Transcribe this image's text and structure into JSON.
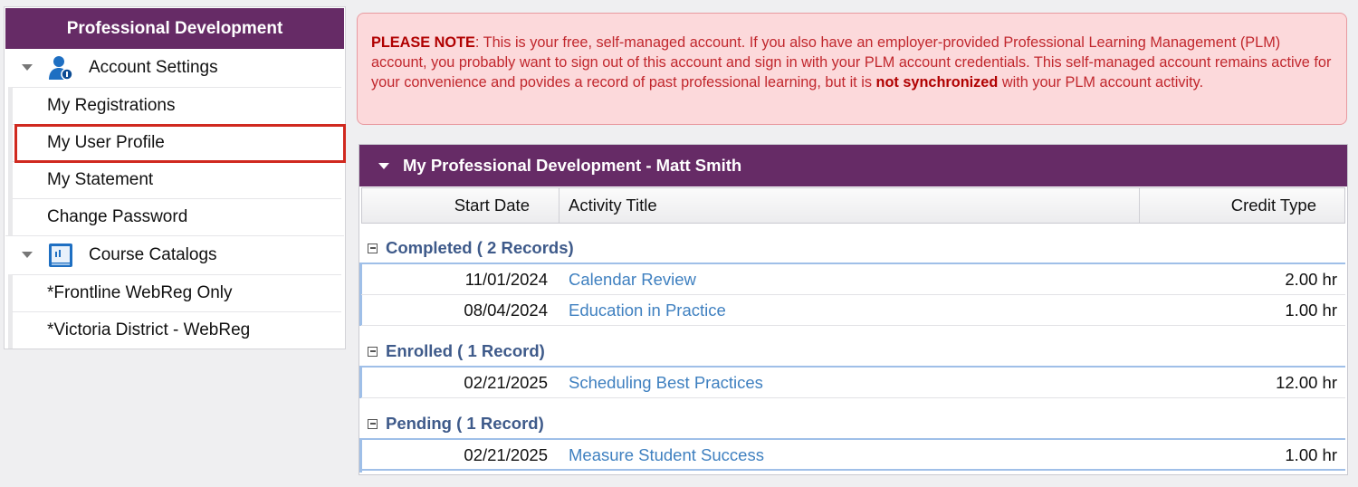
{
  "sidebar": {
    "title": "Professional Development",
    "groups": [
      {
        "label": "Account Settings",
        "icon": "user-settings-icon",
        "items": [
          "My Registrations",
          "My User Profile",
          "My Statement",
          "Change Password"
        ]
      },
      {
        "label": "Course Catalogs",
        "icon": "catalog-icon",
        "items": [
          "*Frontline WebReg Only",
          "*Victoria District - WebReg"
        ]
      }
    ],
    "highlighted_item": "My User Profile"
  },
  "notice": {
    "label": "PLEASE NOTE",
    "text_before": ": This is your free, self-managed account. If you also have an employer-provided Professional Learning Management (PLM) account, you probably want to sign out of this account and sign in with your PLM account credentials. This self-managed account remains active for your convenience and povides a record of past professional learning, but it is ",
    "bold_text": "not synchronized",
    "text_after": " with your PLM account activity."
  },
  "panel": {
    "title": "My Professional Development - Matt Smith",
    "columns": {
      "start_date": "Start Date",
      "activity_title": "Activity Title",
      "credit_type": "Credit Type"
    },
    "groups": [
      {
        "label": "Completed ( 2 Records)",
        "rows": [
          {
            "date": "11/01/2024",
            "title": "Calendar Review",
            "credit": "2.00 hr"
          },
          {
            "date": "08/04/2024",
            "title": "Education in Practice",
            "credit": "1.00 hr"
          }
        ]
      },
      {
        "label": "Enrolled ( 1 Record)",
        "rows": [
          {
            "date": "02/21/2025",
            "title": "Scheduling Best Practices",
            "credit": "12.00 hr"
          }
        ]
      },
      {
        "label": "Pending ( 1 Record)",
        "rows": [
          {
            "date": "02/21/2025",
            "title": "Measure Student Success",
            "credit": "1.00 hr"
          }
        ]
      }
    ]
  },
  "colors": {
    "header_purple": "#662b66",
    "notice_bg": "#fcd9db",
    "notice_text": "#c1272d",
    "link_blue": "#3f80c0",
    "group_blue": "#3e5a8a",
    "highlight_red": "#d0291f"
  }
}
